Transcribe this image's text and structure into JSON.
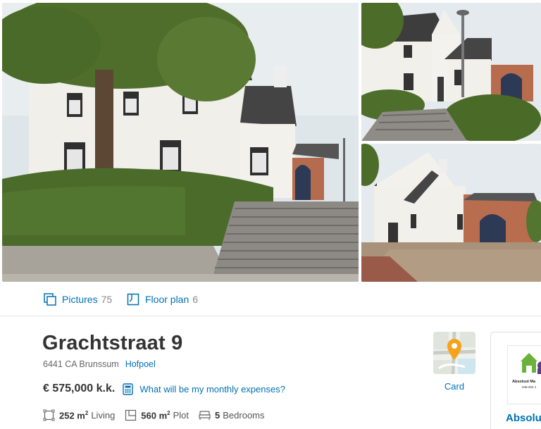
{
  "gallery": {
    "photos": [
      {
        "alt": "main-photo"
      },
      {
        "alt": "side-photo-top"
      },
      {
        "alt": "side-photo-bottom"
      }
    ]
  },
  "media": {
    "pictures_label": "Pictures",
    "pictures_count": "75",
    "floorplan_label": "Floor plan",
    "floorplan_count": "6"
  },
  "listing": {
    "title": "Grachtstraat 9",
    "postal_city": "6441 CA Brunssum",
    "neighbourhood": "Hofpoel",
    "price": "€ 575,000 k.k.",
    "expenses_link": "What will be my monthly expenses?",
    "features": [
      {
        "value": "252 m",
        "sup": "2",
        "label": "Living",
        "icon": "floor-area-icon"
      },
      {
        "value": "560 m",
        "sup": "2",
        "label": "Plot",
        "icon": "plot-icon"
      },
      {
        "value": "5",
        "sup": "",
        "label": "Bedrooms",
        "icon": "bed-icon"
      }
    ]
  },
  "map": {
    "label": "Card"
  },
  "agent": {
    "logo_line1": "Absoluut Ma",
    "logo_line2": "046-204 1",
    "name": "Absolu"
  },
  "colors": {
    "link": "#0071b3",
    "text": "#333333",
    "pin": "#f7a21b"
  }
}
